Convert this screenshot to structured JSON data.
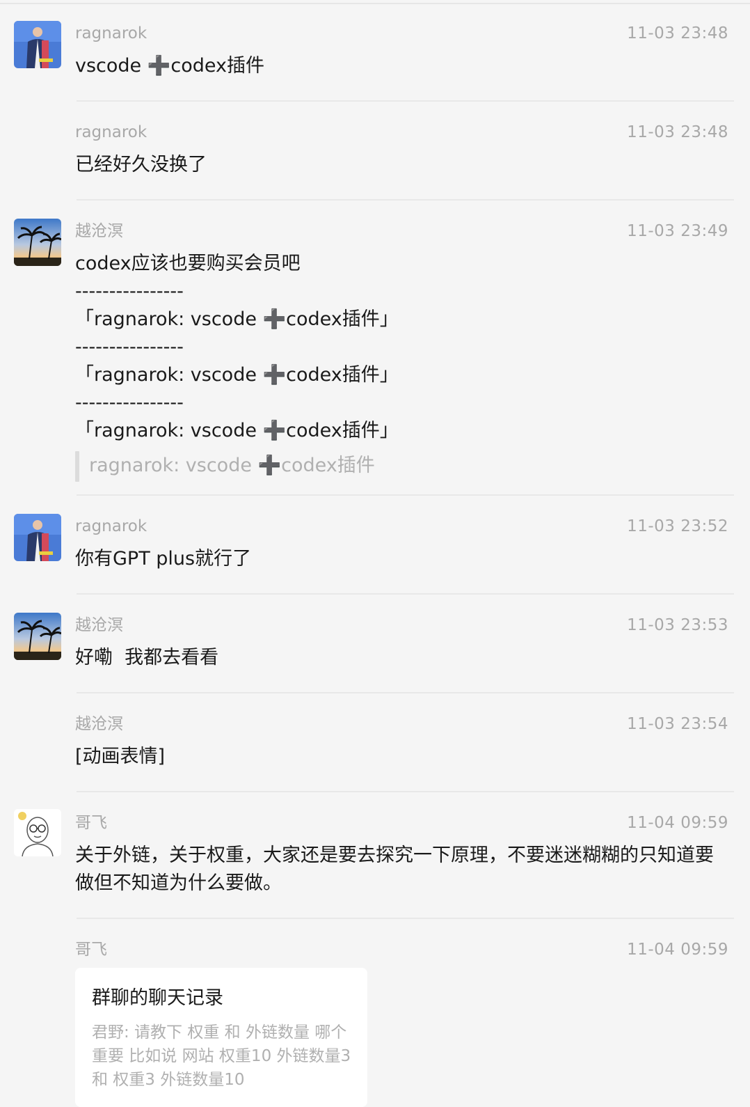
{
  "messages": [
    {
      "sender": "ragnarok",
      "time": "11-03 23:48",
      "text": "vscode ➕codex插件",
      "avatar": "photo-man"
    },
    {
      "sender": "ragnarok",
      "time": "11-03 23:48",
      "text": "已经好久没换了"
    },
    {
      "sender": "越沧溟",
      "time": "11-03 23:49",
      "avatar": "beach-palms",
      "lines": [
        "codex应该也要购买会员吧",
        "----------------",
        "「ragnarok: vscode ➕codex插件」",
        "----------------",
        "「ragnarok: vscode ➕codex插件」",
        "----------------",
        "「ragnarok: vscode ➕codex插件」"
      ],
      "quote": "ragnarok: vscode ➕codex插件"
    },
    {
      "sender": "ragnarok",
      "time": "11-03 23:52",
      "text": "你有GPT plus就行了",
      "avatar": "photo-man"
    },
    {
      "sender": "越沧溟",
      "time": "11-03 23:53",
      "text": "好嘞  我都去看看",
      "avatar": "beach-palms"
    },
    {
      "sender": "越沧溟",
      "time": "11-03 23:54",
      "text": "[动画表情]"
    },
    {
      "sender": "哥飞",
      "time": "11-04 09:59",
      "avatar": "cartoon-glasses-man",
      "text": "关于外链，关于权重，大家还是要去探究一下原理，不要迷迷糊糊的只知道要做但不知道为什么要做。"
    },
    {
      "sender": "哥飞",
      "time": "11-04 09:59",
      "card": {
        "title": "群聊的聊天记录",
        "body": "君野: 请教下  权重 和  外链数量 哪个重要 比如说  网站  权重10  外链数量3     和  权重3  外链数量10"
      }
    }
  ],
  "colors": {
    "background": "#f5f5f5",
    "meta_text": "#a8a8a8",
    "body_text": "#1a1a1a",
    "divider": "#e8e8e8",
    "card_bg": "#ffffff"
  }
}
